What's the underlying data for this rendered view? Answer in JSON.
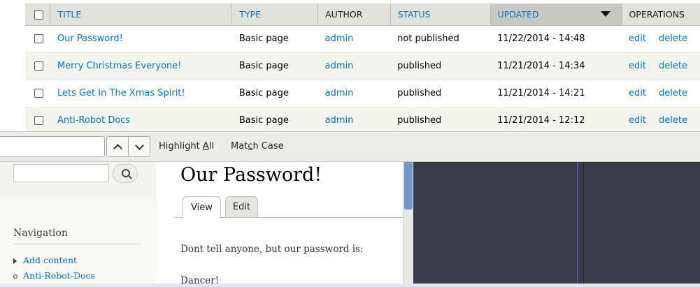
{
  "table": {
    "headers": {
      "title": "TITLE",
      "type": "TYPE",
      "author": "AUTHOR",
      "status": "STATUS",
      "updated": "UPDATED",
      "operations": "OPERATIONS"
    },
    "sorted_column": "updated",
    "sort_direction": "descending",
    "rows": [
      {
        "title": "Our Password!",
        "type": "Basic page",
        "author": "admin",
        "status": "not published",
        "updated": "11/22/2014 - 14:48",
        "edit": "edit",
        "delete": "delete"
      },
      {
        "title": "Merry Christmas Everyone!",
        "type": "Basic page",
        "author": "admin",
        "status": "published",
        "updated": "11/21/2014 - 14:34",
        "edit": "edit",
        "delete": "delete"
      },
      {
        "title": "Lets Get In The Xmas Spirit!",
        "type": "Basic page",
        "author": "admin",
        "status": "published",
        "updated": "11/21/2014 - 14:21",
        "edit": "edit",
        "delete": "delete"
      },
      {
        "title": "Anti-Robot Docs",
        "type": "Basic page",
        "author": "admin",
        "status": "published",
        "updated": "11/21/2014 - 12:12",
        "edit": "edit",
        "delete": "delete"
      }
    ]
  },
  "findbar": {
    "query": "",
    "highlight_all_pre": "Highlight ",
    "highlight_all_key": "A",
    "highlight_all_post": "ll",
    "match_case_pre": "Mat",
    "match_case_key": "c",
    "match_case_post": "h Case",
    "prev_icon": "chevron-up-icon",
    "next_icon": "chevron-down-icon"
  },
  "sidebar": {
    "search_value": "",
    "search_icon": "search-icon",
    "navigation_title": "Navigation",
    "items": [
      {
        "label": "Add content",
        "marker": "collapsed-triangle"
      },
      {
        "label": "Anti-Robot-Docs",
        "marker": "bullet"
      }
    ]
  },
  "page": {
    "title": "Our Password!",
    "tabs": [
      {
        "label": "View",
        "active": true
      },
      {
        "label": "Edit",
        "active": false
      }
    ],
    "body_line1": "Dont tell anyone, but our password is:",
    "body_line2": "Dancer!"
  },
  "colors": {
    "link": "#0074bd",
    "header_bg": "#e1e2dc",
    "sorted_header_bg": "#c8c9c3",
    "dev_panel_bg": "#393b4b",
    "scroll_thumb": "#6f98c9"
  }
}
